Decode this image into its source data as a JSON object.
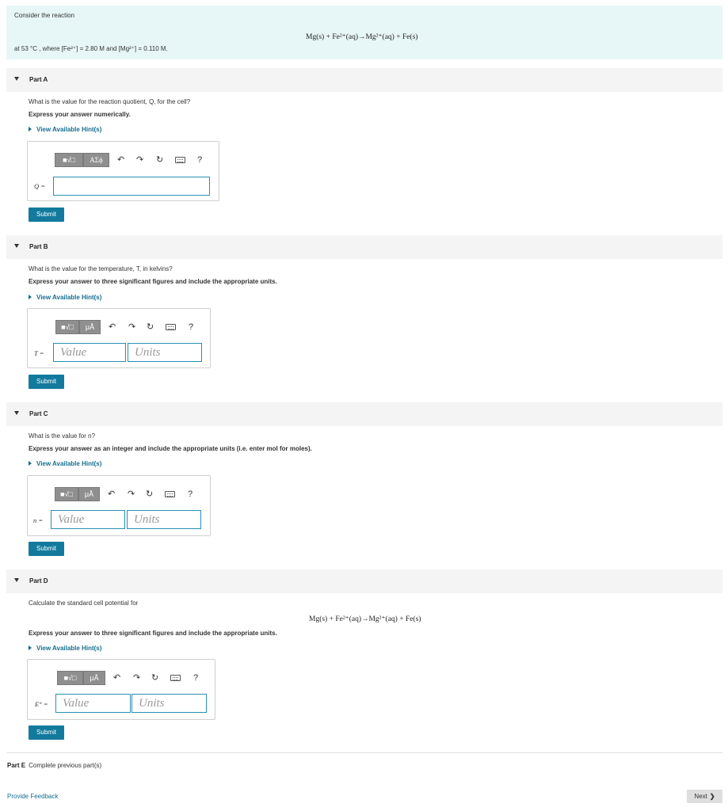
{
  "intro": {
    "consider": "Consider the reaction",
    "equation": "Mg(s) + Fe²⁺(aq)→Mg²⁺(aq) + Fe(s)",
    "conditions": "at 53 °C , where [Fe²⁺] = 2.80 M and [Mg²⁺] = 0.110 M."
  },
  "toolbar": {
    "templates_icon": "■√□",
    "greek_label": "AΣϕ",
    "units_label": "μÅ",
    "undo": "↶",
    "redo": "↷",
    "reset": "↻",
    "help": "?"
  },
  "hint_label": "View Available Hint(s)",
  "submit_label": "Submit",
  "value_placeholder": "Value",
  "units_placeholder": "Units",
  "parts": {
    "a": {
      "title": "Part A",
      "question": "What is the value for the reaction quotient, Q, for the cell?",
      "instruction": "Express your answer numerically.",
      "var_label": "Q ="
    },
    "b": {
      "title": "Part B",
      "question": "What is the value for the temperature, T, in kelvins?",
      "instruction": "Express your answer to three significant figures and include the appropriate units.",
      "var_label": "T ="
    },
    "c": {
      "title": "Part C",
      "question": "What is the value for n?",
      "instruction": "Express your answer as an integer and include the appropriate units (i.e. enter mol for moles).",
      "var_label": "n ="
    },
    "d": {
      "title": "Part D",
      "question": "Calculate the standard cell potential for",
      "equation": "Mg(s) + Fe²⁺(aq)→Mg²⁺(aq) + Fe(s)",
      "instruction": "Express your answer to three significant figures and include the appropriate units.",
      "var_label": "E° ="
    },
    "e": {
      "title": "Part E",
      "status": "Complete previous part(s)"
    }
  },
  "footer": {
    "feedback": "Provide Feedback",
    "next": "Next"
  }
}
